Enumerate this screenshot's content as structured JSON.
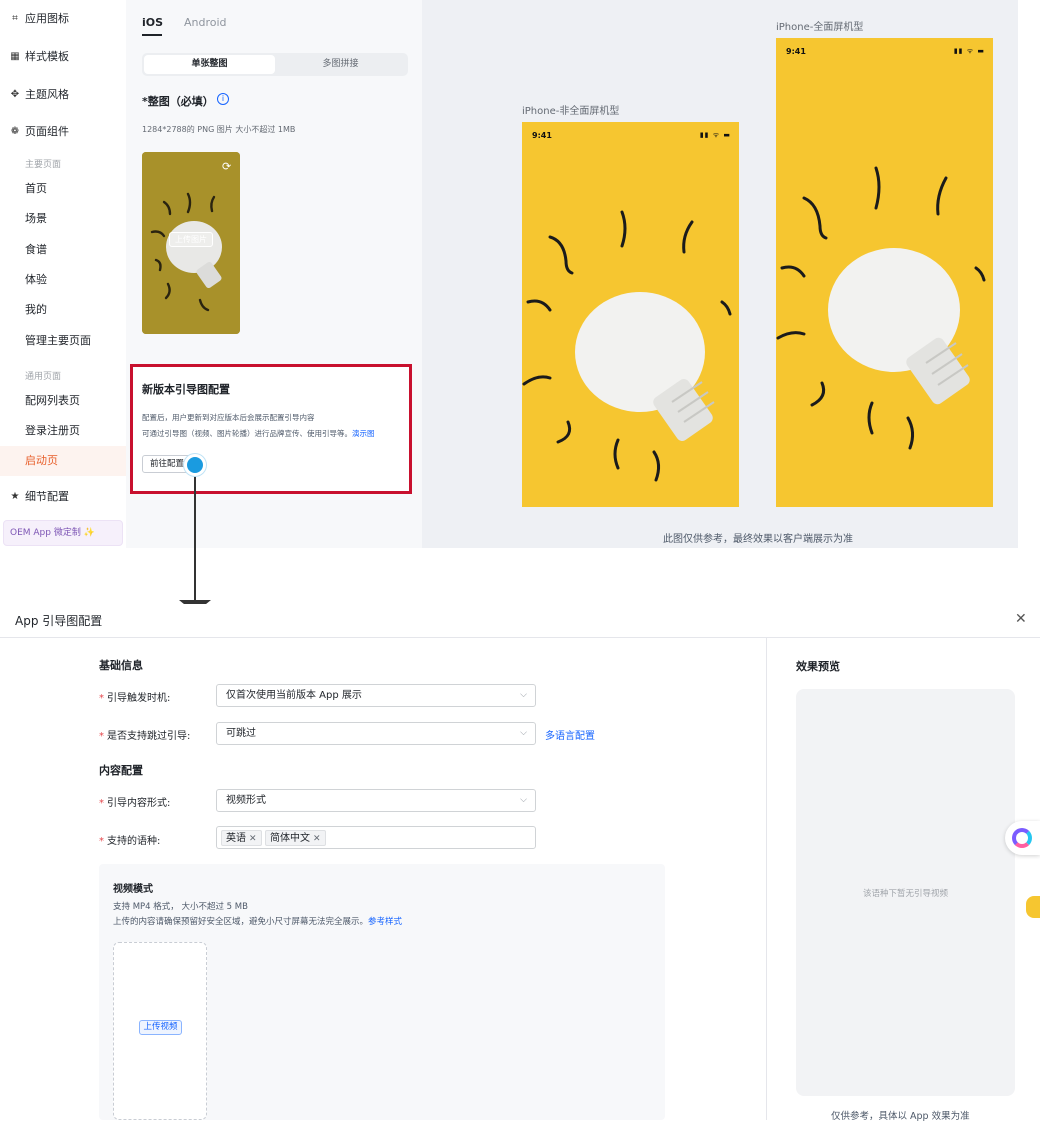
{
  "sidebar": {
    "main_items": [
      {
        "label": "应用图标",
        "icon": "app-icon"
      },
      {
        "label": "样式模板",
        "icon": "grid-icon"
      },
      {
        "label": "主题风格",
        "icon": "palette-icon"
      },
      {
        "label": "页面组件",
        "icon": "component-icon"
      }
    ],
    "group_main": "主要页面",
    "main_pages": [
      "首页",
      "场景",
      "食谱",
      "体验",
      "我的",
      "管理主要页面"
    ],
    "group_common": "通用页面",
    "common_pages": [
      "配网列表页",
      "登录注册页",
      "启动页"
    ],
    "detail_config": "细节配置",
    "oem": "OEM App 微定制 ✨"
  },
  "config": {
    "tabs": [
      "iOS",
      "Android"
    ],
    "segments": [
      "单张整图",
      "多图拼接"
    ],
    "field_title": "*整图（必填）",
    "spec": "1284*2788的 PNG 图片 大小不超过 1MB",
    "upload_label": "上传图片",
    "guide_title": "新版本引导图配置",
    "guide_desc1": "配置后，用户更新到对应版本后会展示配置引导内容",
    "guide_desc2": "可通过引导图（视频、图片轮播）进行品牌宣传、使用引导等。",
    "guide_link": "演示图",
    "goto_button": "前往配置"
  },
  "preview": {
    "label_nonfull": "iPhone-非全面屏机型",
    "label_full": "iPhone-全面屏机型",
    "time": "9:41",
    "note": "此图仅供参考，最终效果以客户端展示为准"
  },
  "dialog": {
    "title": "App 引导图配置",
    "section_basic": "基础信息",
    "trigger_label": "引导触发时机:",
    "trigger_value": "仅首次使用当前版本 App 展示",
    "skip_label": "是否支持跳过引导:",
    "skip_value": "可跳过",
    "multilang_link": "多语言配置",
    "section_content": "内容配置",
    "form_label": "引导内容形式:",
    "form_value": "视频形式",
    "lang_label": "支持的语种:",
    "lang_tags": [
      "英语",
      "简体中文"
    ],
    "video_title": "视频模式",
    "video_spec": "支持 MP4 格式， 大小不超过 5 MB",
    "video_note": "上传的内容请确保预留好安全区域，避免小尺寸屏幕无法完全展示。",
    "video_note_link": "参考样式",
    "upload_video": "上传视频",
    "preview_title": "效果预览",
    "preview_empty": "该语种下暂无引导视频",
    "preview_footer": "仅供参考，具体以 App 效果为准"
  }
}
